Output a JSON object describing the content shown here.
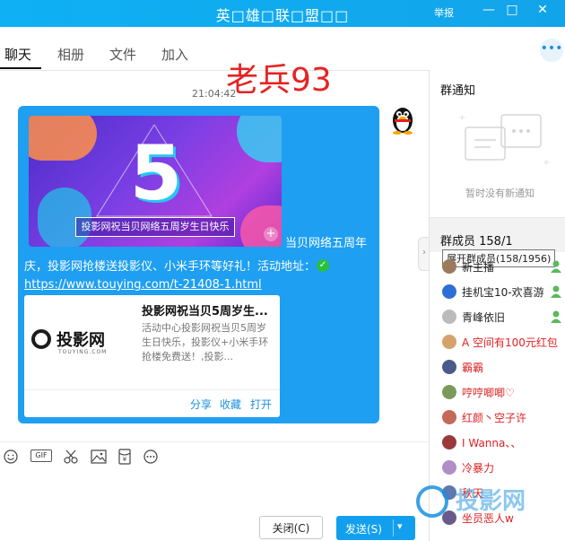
{
  "window": {
    "title": "英□雄□联□盟□□",
    "report_label": "举报",
    "minimize": "—",
    "maximize": "□",
    "close": "✕"
  },
  "tabs": [
    "聊天",
    "相册",
    "文件",
    "加入"
  ],
  "overlay_text": "老兵93",
  "timestamp": "21:04:42",
  "message": {
    "banner_caption": "投影网祝当贝网络五周岁生日快乐",
    "banner_number": "5",
    "text_line1": "当贝网络五周年",
    "text_line2": "庆，投影网抢楼送投影仪、小米手环等好礼！活动地址：",
    "link": "https://www.touying.com/t-21408-1.html",
    "card": {
      "logo_text": "投影网",
      "logo_sub": "TOUYING.COM",
      "title": "投影网祝当贝5周岁生...",
      "desc": "活动中心投影网祝当贝5周岁生日快乐，投影仪+小米手环抢楼免费送！,投影...",
      "actions": [
        "分享",
        "收藏",
        "打开"
      ]
    }
  },
  "toolbar_icons": [
    "emoji-icon",
    "gif-icon",
    "scissors-icon",
    "image-icon",
    "red-packet-icon",
    "more-icon"
  ],
  "toolbar": {
    "gif_label": "GIF"
  },
  "buttons": {
    "close": "关闭(C)",
    "send": "发送(S)",
    "send_dropdown": "▾"
  },
  "right_panel": {
    "notice_title": "群通知",
    "notice_empty": "暂时没有新通知",
    "members_title": "群成员 158/1",
    "tooltip": "展开群成员(158/1956)",
    "members": [
      {
        "name": "新主播",
        "color": "#222",
        "avatar": "#9a7b5c",
        "admin": true
      },
      {
        "name": "挂机宝10-欢喜游",
        "color": "#222",
        "avatar": "#2e6fd6",
        "admin": true
      },
      {
        "name": "青峰依旧",
        "color": "#222",
        "avatar": "#bbbbbb",
        "admin": true
      },
      {
        "name": "A  空间有100元红包",
        "color": "#d22",
        "avatar": "#d4a26a",
        "admin": false
      },
      {
        "name": "霸霸",
        "color": "#d22",
        "avatar": "#4a5a8a",
        "admin": false
      },
      {
        "name": "哼哼唧唧♡",
        "color": "#d22",
        "avatar": "#7a9a5a",
        "admin": false
      },
      {
        "name": "红颜丶空子许",
        "color": "#d22",
        "avatar": "#c46a5a",
        "admin": false
      },
      {
        "name": "I Wanna、、",
        "color": "#d22",
        "avatar": "#9a3a3a",
        "admin": false
      },
      {
        "name": "冷暴力",
        "color": "#d22",
        "avatar": "#b08fc6",
        "admin": false
      },
      {
        "name": "秋天",
        "color": "#d22",
        "avatar": "#5a7ab0",
        "admin": false
      },
      {
        "name": "坐员恶人w",
        "color": "#d22",
        "avatar": "#6a5a8a",
        "admin": false
      }
    ]
  },
  "watermark": "投影网"
}
